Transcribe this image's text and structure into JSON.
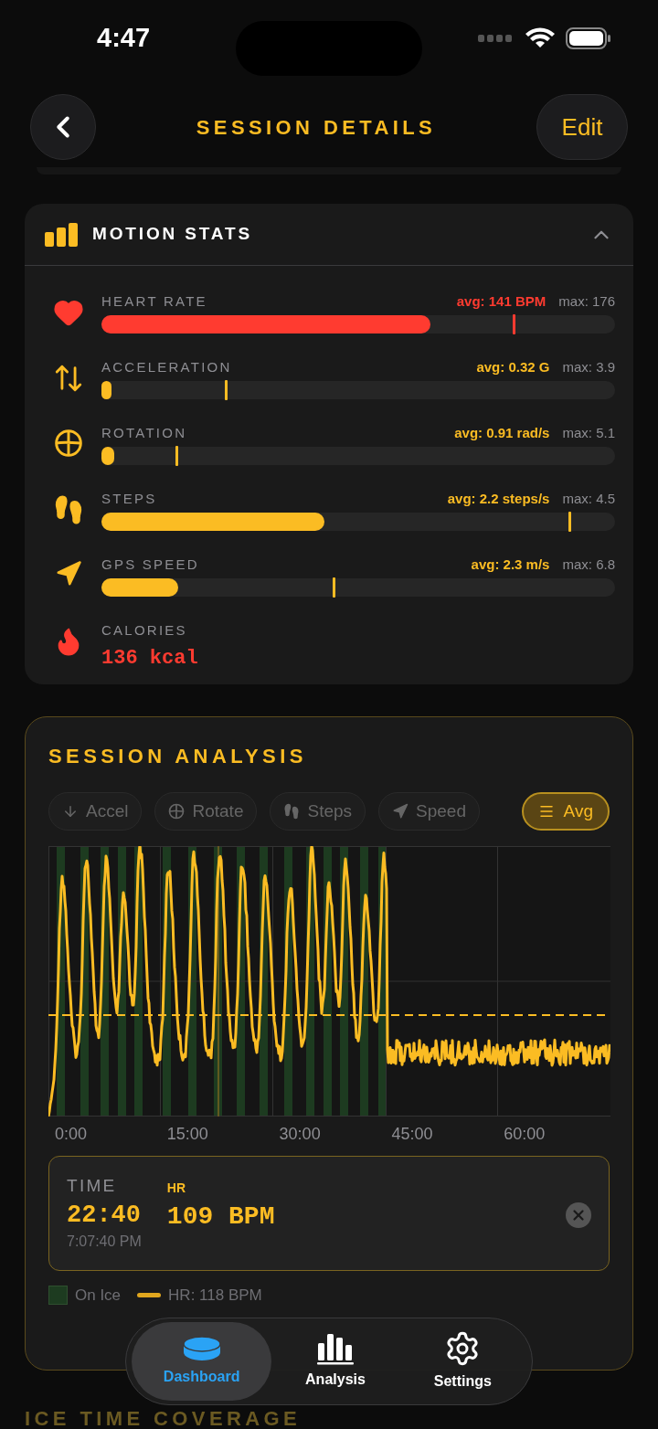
{
  "status_bar": {
    "time": "4:47"
  },
  "header": {
    "title": "SESSION DETAILS",
    "action": "Edit"
  },
  "motion_stats": {
    "title": "MOTION STATS",
    "expanded": true,
    "metrics": [
      {
        "kind": "bar",
        "label": "HEART RATE",
        "avg": "avg: 141 BPM",
        "max": "max: 176",
        "color": "#ff3b30",
        "level": 0.64,
        "max_marker": {
          "level": 0.8
        }
      },
      {
        "kind": "bar",
        "label": "ACCELERATION",
        "avg": "avg: 0.32 G",
        "max": "max: 3.9",
        "color": "#fbbc23",
        "level": 0.02,
        "max_marker": {
          "level": 0.24
        }
      },
      {
        "kind": "bar",
        "label": "ROTATION",
        "avg": "avg: 0.91 rad/s",
        "max": "max: 5.1",
        "color": "#fbbc23",
        "level": 0.025,
        "max_marker": {
          "level": 0.145
        }
      },
      {
        "kind": "bar",
        "label": "STEPS",
        "avg": "avg: 2.2 steps/s",
        "max": "max: 4.5",
        "color": "#fbbc23",
        "level": 0.435,
        "max_marker": {
          "level": 0.91
        }
      },
      {
        "kind": "bar",
        "label": "GPS SPEED",
        "avg": "avg: 2.3 m/s",
        "max": "max: 6.8",
        "color": "#fbbc23",
        "level": 0.15,
        "max_marker": {
          "level": 0.45
        }
      },
      {
        "kind": "value",
        "label": "CALORIES",
        "value": "136 kcal",
        "color": "#ff3b30"
      }
    ]
  },
  "session_analysis": {
    "title": "SESSION ANALYSIS",
    "filters": [
      {
        "label": "Accel",
        "selected": false
      },
      {
        "label": "Rotate",
        "selected": false
      },
      {
        "label": "Steps",
        "selected": false
      },
      {
        "label": "Speed",
        "selected": false
      },
      {
        "label": "Avg",
        "selected": true
      }
    ],
    "x_labels": [
      "0:00",
      "15:00",
      "30:00",
      "45:00",
      "60:00"
    ],
    "readout": {
      "time_label": "TIME",
      "elapsed": "22:40",
      "clock": "7:07:40 PM",
      "metric_label": "HR",
      "metric_value": "109 BPM"
    },
    "legend": [
      {
        "kind": "swatch",
        "label": "On Ice",
        "color": "#1d3b20"
      },
      {
        "kind": "line",
        "label": "HR: 118 BPM",
        "color": "#e0a61e"
      }
    ]
  },
  "next_section": {
    "title": "ICE TIME COVERAGE"
  },
  "tab_bar": [
    {
      "label": "Dashboard",
      "selected": true
    },
    {
      "label": "Analysis",
      "selected": false
    },
    {
      "label": "Settings",
      "selected": false
    }
  ]
}
